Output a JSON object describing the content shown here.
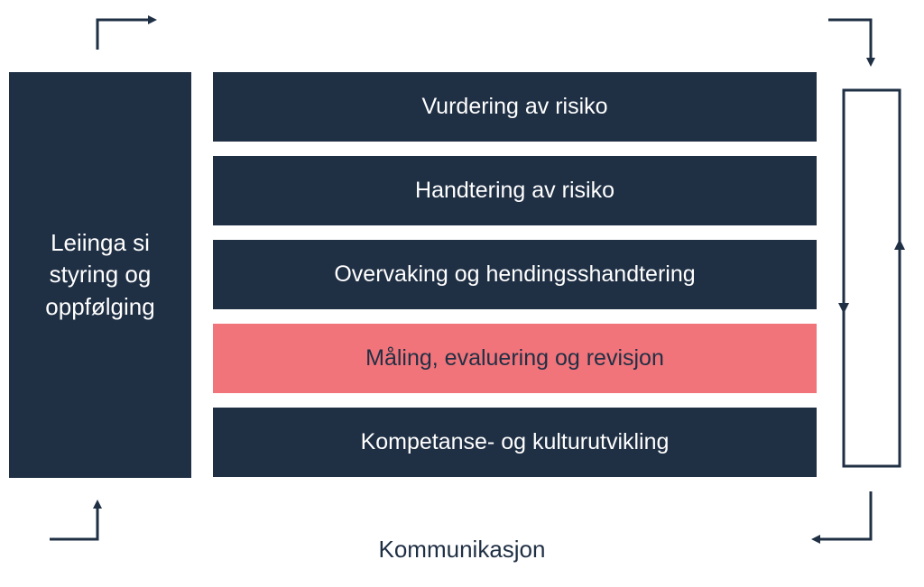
{
  "diagram": {
    "sidebar_label": "Leiinga si styring og oppfølging",
    "blocks": [
      {
        "label": "Vurdering av risiko",
        "highlighted": false
      },
      {
        "label": "Handtering av risiko",
        "highlighted": false
      },
      {
        "label": "Overvaking og hendingsshandtering",
        "highlighted": false
      },
      {
        "label": "Måling, evaluering og revisjon",
        "highlighted": true
      },
      {
        "label": "Kompetanse- og kulturutvikling",
        "highlighted": false
      }
    ],
    "bottom_label": "Kommunikasjon",
    "colors": {
      "primary": "#1f2f44",
      "highlight": "#f1747a",
      "text_light": "#ffffff"
    }
  }
}
